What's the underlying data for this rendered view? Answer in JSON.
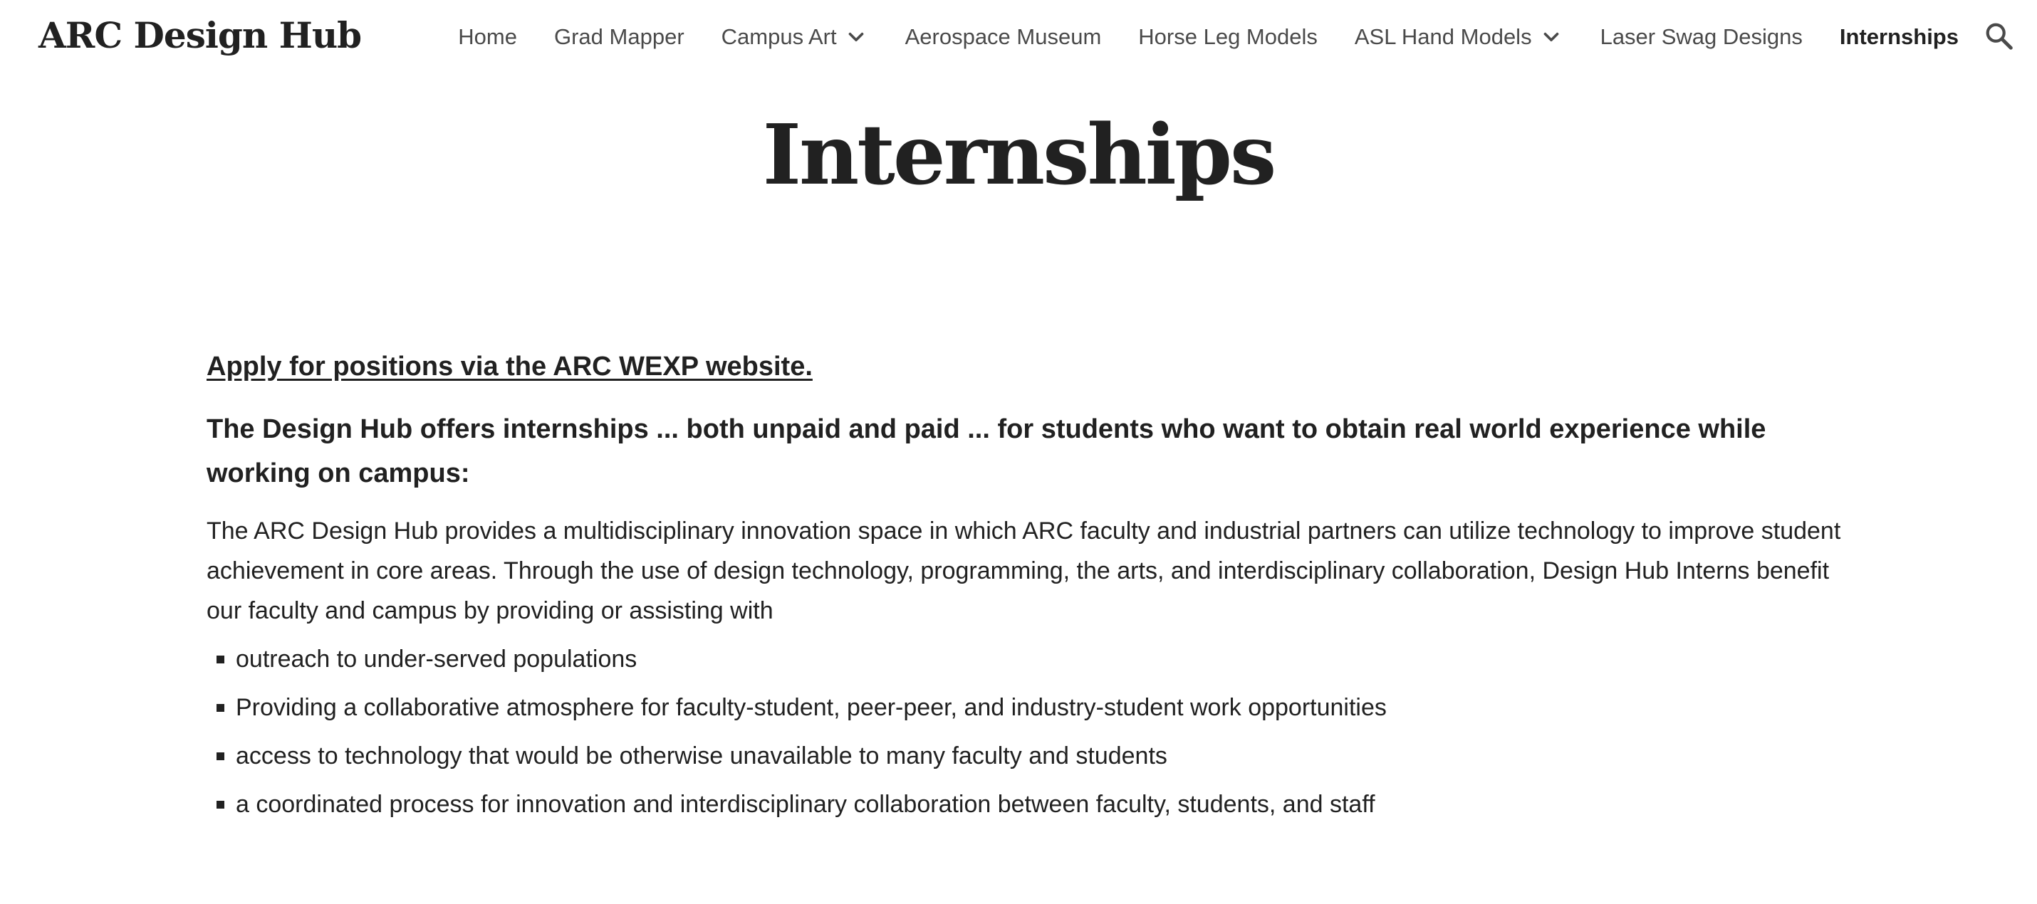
{
  "header": {
    "site_title": "ARC Design Hub",
    "nav": {
      "home": "Home",
      "grad_mapper": "Grad Mapper",
      "campus_art": "Campus Art",
      "aerospace_museum": "Aerospace Museum",
      "horse_leg_models": "Horse Leg Models",
      "asl_hand_models": "ASL Hand Models",
      "laser_swag_designs": "Laser Swag Designs",
      "internships": "Internships"
    },
    "active_item": "Internships",
    "search_icon": "search-icon"
  },
  "main": {
    "page_title": "Internships",
    "apply_link": "Apply for positions via the ARC WEXP website.",
    "lead": "The Design Hub offers internships ... both unpaid and paid ... for students who want to obtain real world experience while working on campus:",
    "body": "The ARC Design Hub provides a multidisciplinary innovation space in which ARC faculty and industrial partners can utilize technology to improve student achievement in core areas.  Through the use of design technology, programming, the arts, and interdisciplinary collaboration, Design Hub Interns benefit our faculty and campus by providing or assisting with",
    "bullets": [
      "outreach to under-served populations",
      "Providing a collaborative atmosphere for faculty-student, peer-peer, and industry-student work opportunities",
      "access to technology that would be otherwise unavailable to many faculty and students",
      "a coordinated process for innovation and interdisciplinary collaboration between faculty, students, and staff"
    ]
  },
  "colors": {
    "text": "#212121",
    "nav_text": "#4a4a4a",
    "background": "#ffffff"
  }
}
